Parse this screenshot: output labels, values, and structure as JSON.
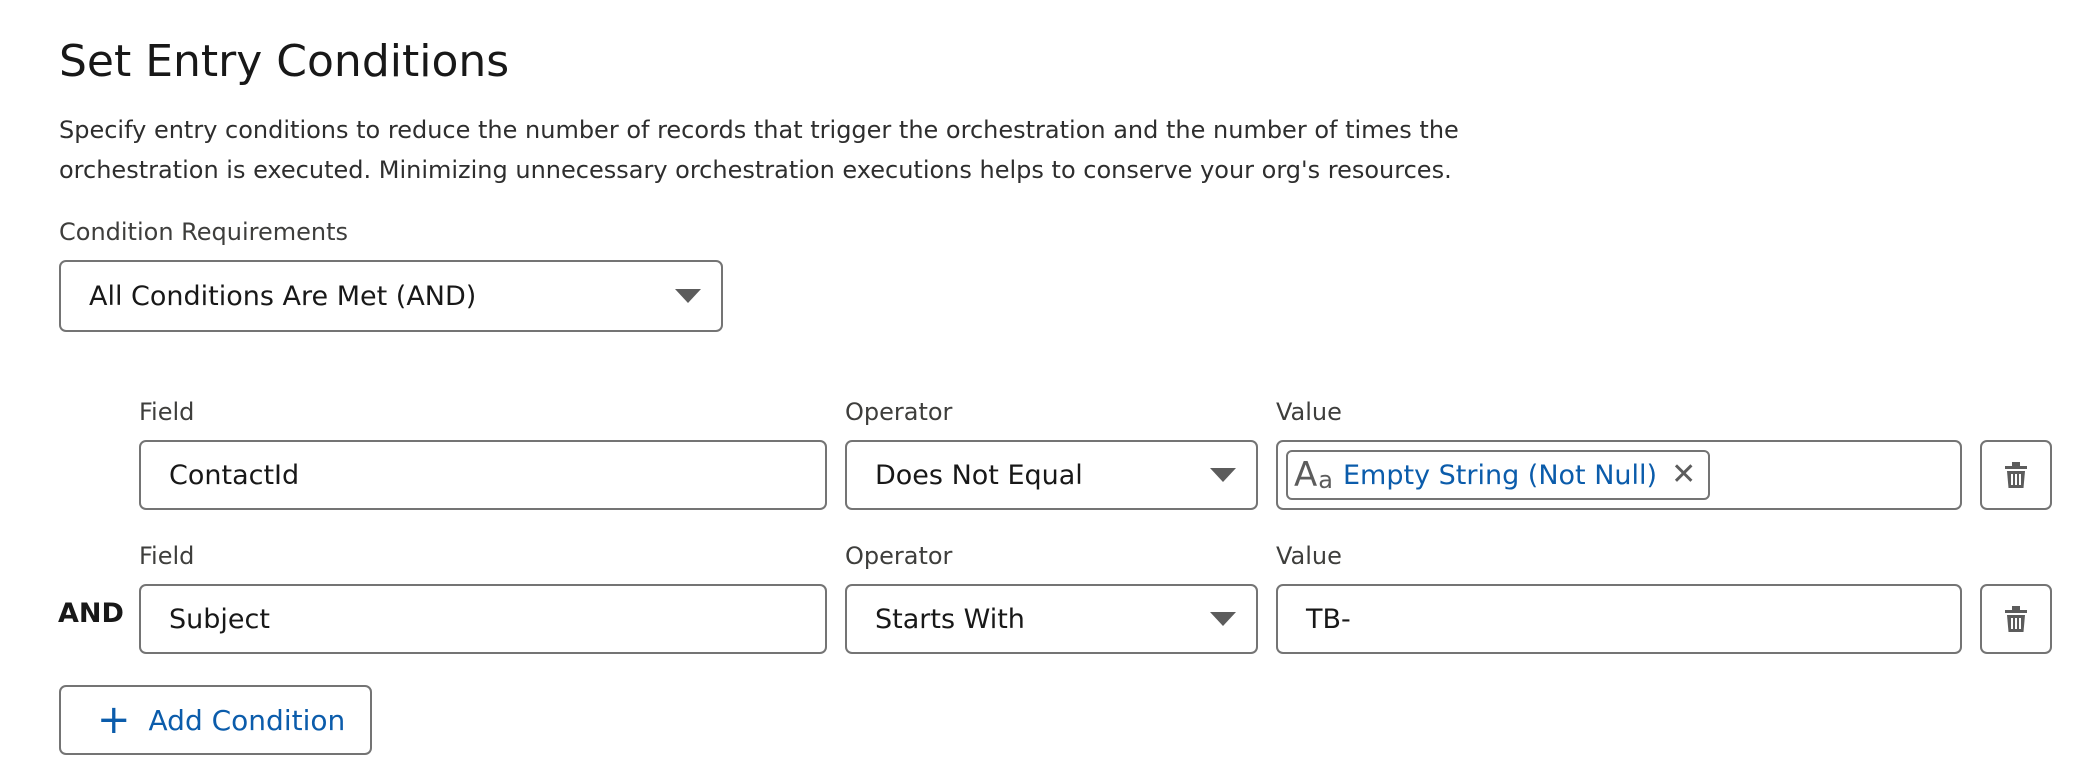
{
  "section": {
    "title": "Set Entry Conditions",
    "description": "Specify entry conditions to reduce the number of records that trigger the orchestration and the number of times the orchestration is executed. Minimizing unnecessary orchestration executions helps to conserve your org's resources."
  },
  "requirements": {
    "label": "Condition Requirements",
    "selected": "All Conditions Are Met (AND)"
  },
  "conditions": [
    {
      "field_label": "Field",
      "field_value": "ContactId",
      "operator_label": "Operator",
      "operator_value": "Does Not Equal",
      "value_label": "Value",
      "value_pill": "Empty String (Not Null)",
      "value_pill_icon": "text-type-icon",
      "delete_icon": "trash-icon"
    },
    {
      "logic": "AND",
      "field_label": "Field",
      "field_value": "Subject",
      "operator_label": "Operator",
      "operator_value": "Starts With",
      "value_label": "Value",
      "value_text": "TB-",
      "delete_icon": "trash-icon"
    }
  ],
  "add_condition": {
    "label": "Add Condition",
    "icon": "plus-icon"
  },
  "colors": {
    "link_blue": "#0b5cab",
    "border_gray": "#747474",
    "text_dark": "#181818"
  }
}
